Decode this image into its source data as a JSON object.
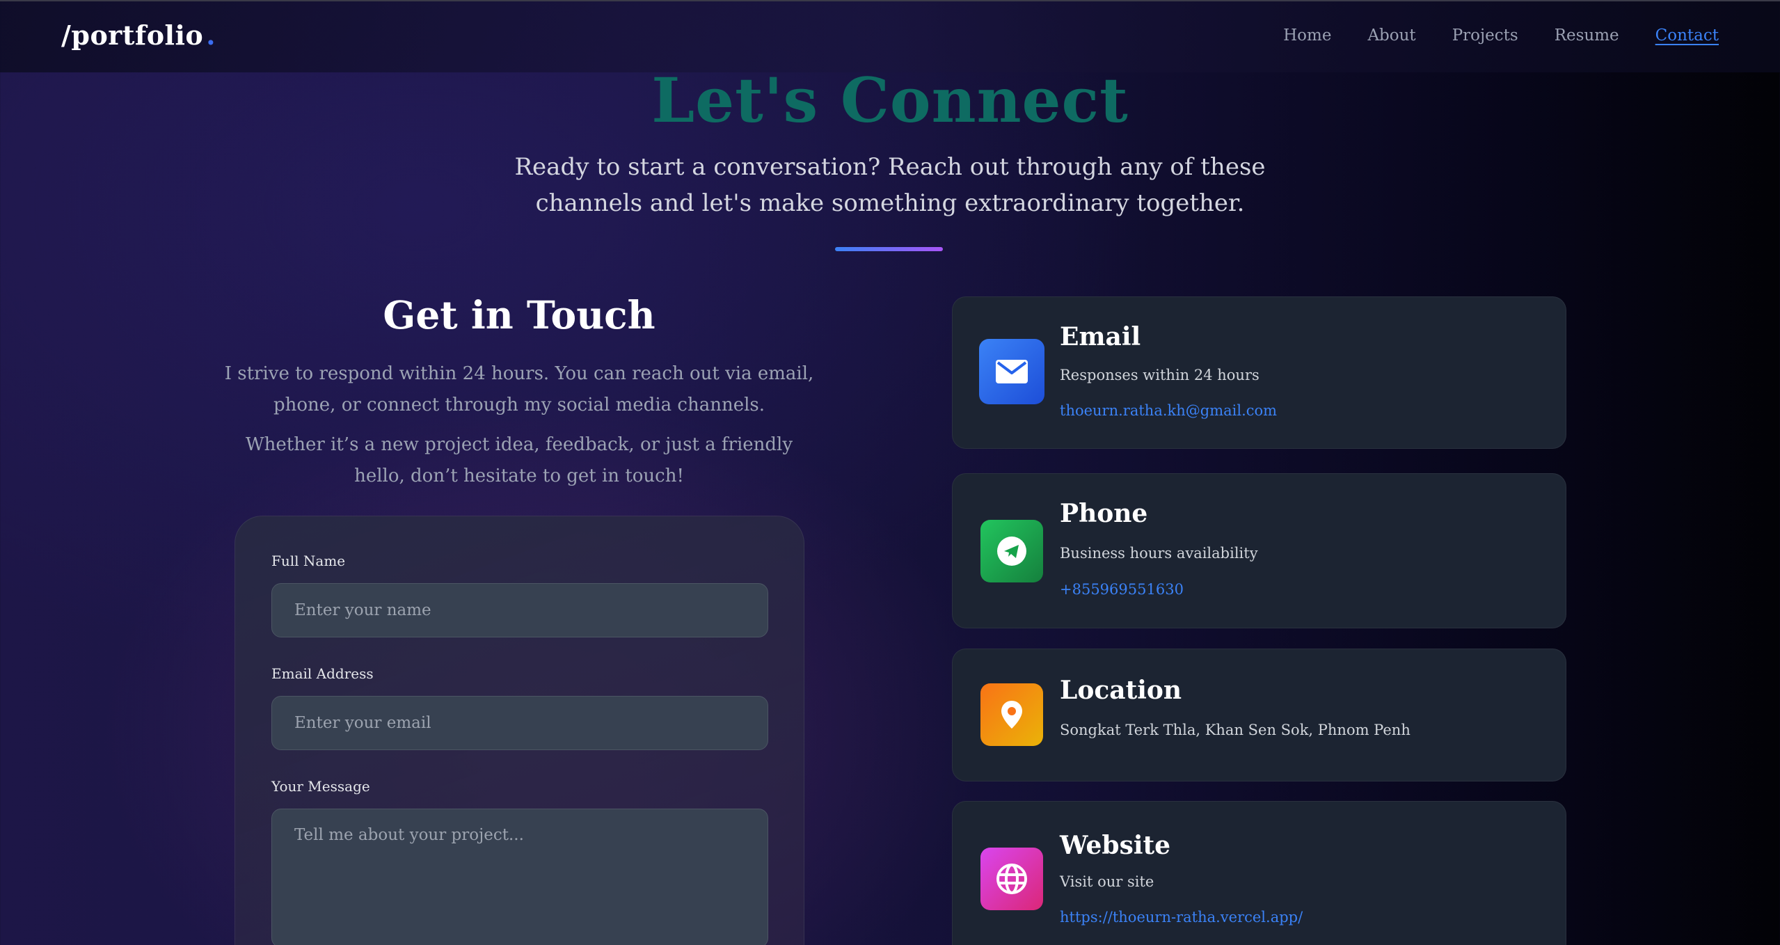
{
  "nav": {
    "logo_text": "/portfolio",
    "logo_dot": ".",
    "links": [
      {
        "label": "Home"
      },
      {
        "label": "About"
      },
      {
        "label": "Projects"
      },
      {
        "label": "Resume"
      },
      {
        "label": "Contact",
        "active": true
      }
    ]
  },
  "hero": {
    "title": "Let's Connect",
    "subtitle": "Ready to start a conversation? Reach out through any of these channels and let's make something extraordinary together."
  },
  "get_in_touch": {
    "title": "Get in Touch",
    "paragraph1": "I strive to respond within 24 hours. You can reach out via email, phone, or connect through my social media channels.",
    "paragraph2": "Whether it’s a new project idea, feedback, or just a friendly hello, don’t hesitate to get in touch!"
  },
  "form": {
    "name_label": "Full Name",
    "name_placeholder": "Enter your name",
    "email_label": "Email Address",
    "email_placeholder": "Enter your email",
    "message_label": "Your Message",
    "message_placeholder": "Tell me about your project..."
  },
  "contacts": {
    "email": {
      "title": "Email",
      "desc": "Responses within 24 hours",
      "link": "thoeurn.ratha.kh@gmail.com",
      "icon": "envelope-icon",
      "color": "#2563eb"
    },
    "phone": {
      "title": "Phone",
      "desc": "Business hours availability",
      "link": "+855969551630",
      "icon": "telegram-icon",
      "color": "#16a34a"
    },
    "location": {
      "title": "Location",
      "desc": "Songkat Terk Thla, Khan Sen Sok, Phnom Penh",
      "icon": "map-pin-icon",
      "color": "#f97316"
    },
    "website": {
      "title": "Website",
      "desc": "Visit our site",
      "link": "https://thoeurn-ratha.vercel.app/",
      "icon": "globe-icon",
      "color": "#c026d3"
    }
  },
  "colors": {
    "accent": "#3b82f6",
    "hero_title": "#0e6b62",
    "card_bg": "#1c2432"
  }
}
